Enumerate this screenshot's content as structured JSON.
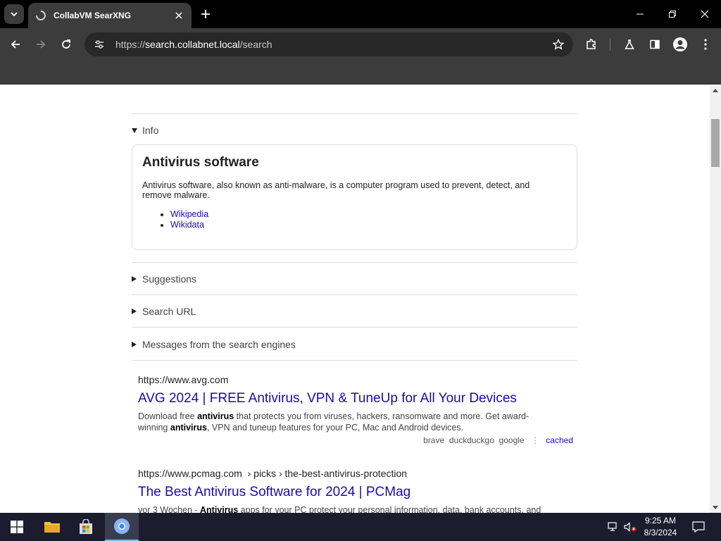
{
  "browser": {
    "tab_title": "CollabVM SearXNG",
    "url_scheme": "https://",
    "url_host": "search.collabnet.local",
    "url_path": "/search"
  },
  "page": {
    "info_label": "Info",
    "infobox": {
      "title": "Antivirus software",
      "description": "Antivirus software, also known as anti-malware, is a computer program used to prevent, detect, and remove malware.",
      "links": [
        "Wikipedia",
        "Wikidata"
      ]
    },
    "sections": {
      "suggestions": "Suggestions",
      "search_url": "Search URL",
      "messages": "Messages from the search engines"
    },
    "results": [
      {
        "url": "https://www.avg.com",
        "breadcrumb": "",
        "title": "AVG 2024 | FREE Antivirus, VPN & TuneUp for All Your Devices",
        "desc_parts": [
          "Download free ",
          "antivirus",
          " that protects you from viruses, hackers, ransomware and more. Get award-winning ",
          "antivirus",
          ", VPN and tuneup features for your PC, Mac and Android devices."
        ],
        "engines": [
          "brave",
          "duckduckgo",
          "google"
        ],
        "cached": "cached"
      },
      {
        "url": "https://www.pcmag.com",
        "breadcrumb": "› picks › the-best-antivirus-protection",
        "title": "The Best Antivirus Software for 2024 | PCMag",
        "desc_parts": [
          "vor 3 Wochen - ",
          "Antivirus",
          " apps for your PC protect your personal information, data, bank accounts, and"
        ]
      }
    ]
  },
  "taskbar": {
    "time": "9:25 AM",
    "date": "8/3/2024"
  },
  "colors": {
    "link": "#1a0dab",
    "chrome_dark": "#3c3c3c",
    "taskbar": "#1b1d2e"
  }
}
